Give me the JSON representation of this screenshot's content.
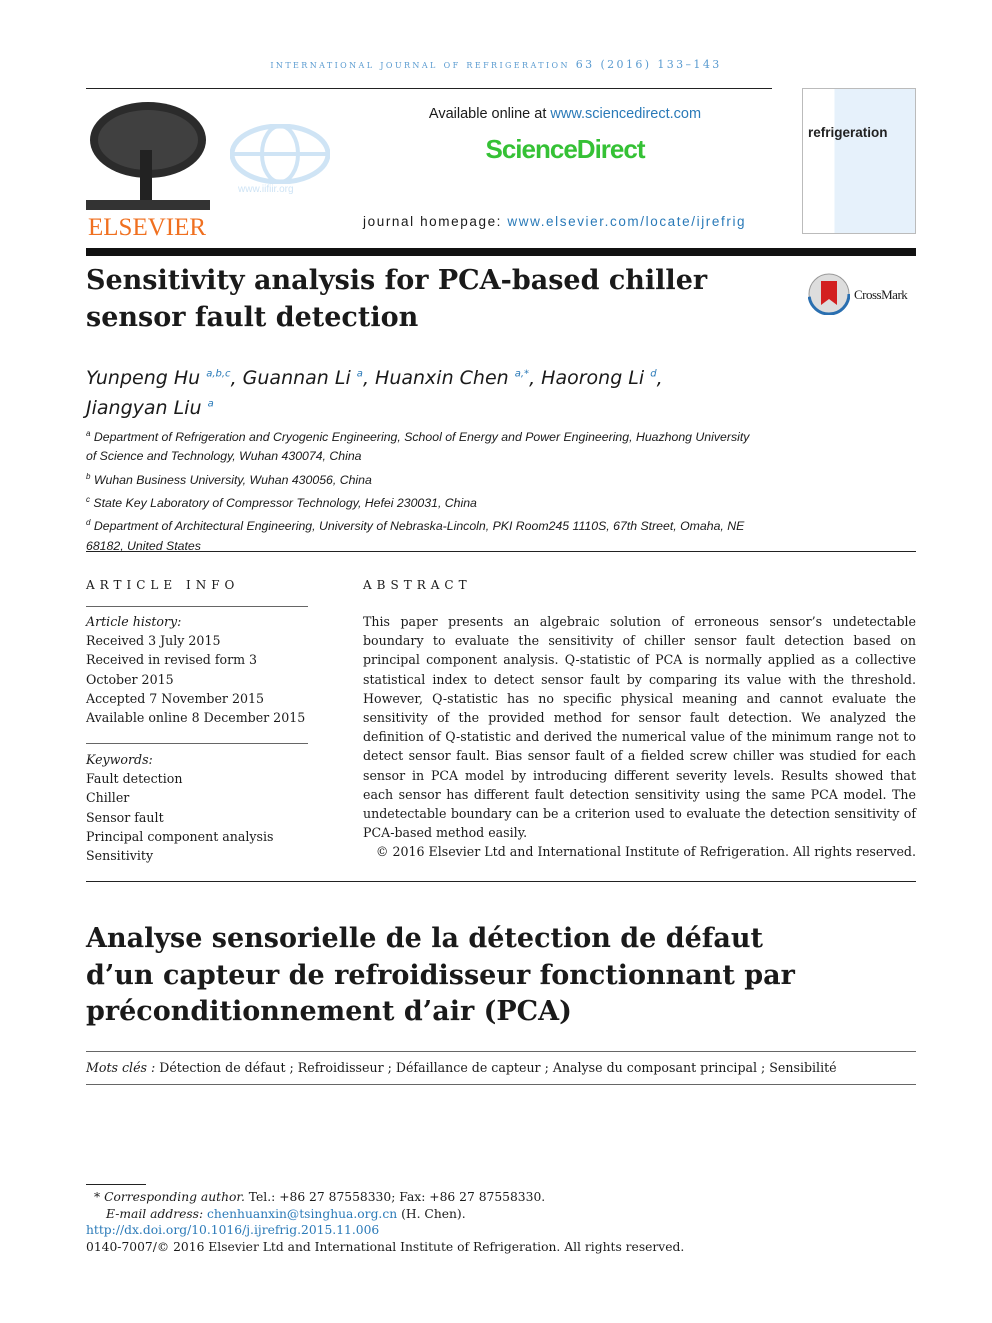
{
  "header": {
    "journal_line": "international journal of refrigeration 63 (2016) 133–143",
    "available_prefix": "Available online at ",
    "available_link": "www.sciencedirect.com",
    "sciencedirect": "ScienceDirect",
    "homepage_prefix": "journal homepage: ",
    "homepage_link": "www.elsevier.com/locate/ijrefrig",
    "elsevier": "ELSEVIER",
    "iifiir_url": "www.iifiir.org",
    "cover_title": "refrigeration",
    "crossmark": "CrossMark",
    "colors": {
      "link": "#2a7ab8",
      "sciencedirect": "#35c135",
      "elsevier": "#f07020"
    }
  },
  "title": "Sensitivity analysis for PCA-based chiller sensor fault detection",
  "authors": [
    {
      "name": "Yunpeng Hu",
      "sup": "a,b,c",
      "sep": ", "
    },
    {
      "name": "Guannan Li",
      "sup": "a",
      "sep": ", "
    },
    {
      "name": "Huanxin Chen",
      "sup": "a,*",
      "sep": ", "
    },
    {
      "name": "Haorong Li",
      "sup": "d",
      "sep": ","
    },
    {
      "name": "Jiangyan Liu",
      "sup": "a",
      "sep": ""
    }
  ],
  "affiliations": [
    {
      "mark": "a",
      "text": "Department of Refrigeration and Cryogenic Engineering, School of Energy and Power Engineering, Huazhong University of Science and Technology, Wuhan 430074, China"
    },
    {
      "mark": "b",
      "text": "Wuhan Business University, Wuhan 430056, China"
    },
    {
      "mark": "c",
      "text": "State Key Laboratory of Compressor Technology, Hefei 230031, China"
    },
    {
      "mark": "d",
      "text": "Department of Architectural Engineering, University of Nebraska-Lincoln, PKI Room245 1110S, 67th Street, Omaha, NE 68182, United States"
    }
  ],
  "article_info": {
    "heading": "ARTICLE INFO",
    "history_label": "Article history:",
    "history": [
      "Received 3 July 2015",
      "Received in revised form 3 October 2015",
      "Accepted 7 November 2015",
      "Available online 8 December 2015"
    ],
    "keywords_label": "Keywords:",
    "keywords": [
      "Fault detection",
      "Chiller",
      "Sensor fault",
      "Principal component analysis",
      "Sensitivity"
    ]
  },
  "abstract": {
    "heading": "ABSTRACT",
    "text": "This paper presents an algebraic solution of erroneous sensor’s undetectable boundary to evaluate the sensitivity of chiller sensor fault detection based on principal component analysis. Q-statistic of PCA is normally applied as a collective statistical index to detect sensor fault by comparing its value with the threshold. However, Q-statistic has no specific physical meaning and cannot evaluate the sensitivity of the provided method for sensor fault detection. We analyzed the definition of Q-statistic and derived the numerical value of the minimum range not to detect sensor fault. Bias sensor fault of a fielded screw chiller was studied for each sensor in PCA model by introducing different severity levels. Results showed that each sensor has different fault detection sensitivity using the same PCA model. The undetectable boundary can be a criterion used to evaluate the detection sensitivity of PCA-based method easily.",
    "copyright": "© 2016 Elsevier Ltd and International Institute of Refrigeration. All rights reserved."
  },
  "french_title": "Analyse sensorielle de la détection de défaut d’un capteur de refroidisseur fonctionnant par préconditionnement d’air (PCA)",
  "mots_cles": {
    "label": "Mots clés :",
    "text": " Détection de défaut ; Refroidisseur ; Défaillance de capteur ; Analyse du composant principal ; Sensibilité"
  },
  "footnotes": {
    "corresponding_label": "Corresponding author.",
    "corresponding_text": " Tel.: +86 27 87558330; Fax: +86 27 87558330.",
    "email_label": "E-mail address:",
    "email": "chenhuanxin@tsinghua.org.cn",
    "email_suffix": " (H. Chen).",
    "doi": "http://dx.doi.org/10.1016/j.ijrefrig.2015.11.006",
    "issn": "0140-7007/© 2016 Elsevier Ltd and International Institute of Refrigeration. All rights reserved."
  }
}
